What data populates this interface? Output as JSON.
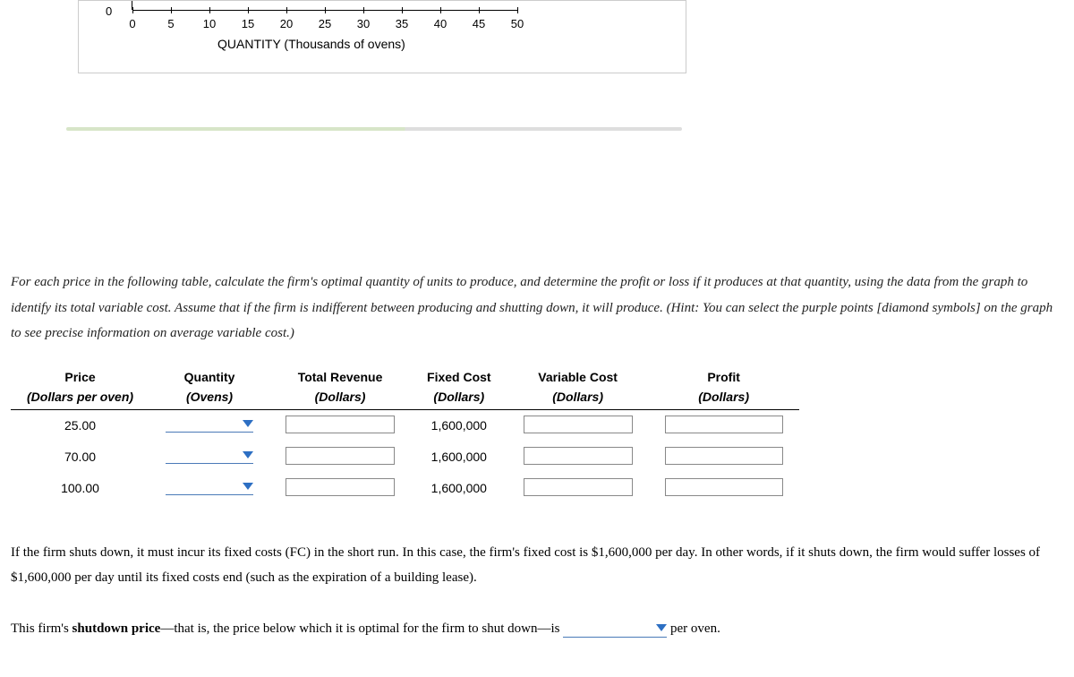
{
  "chart_data": {
    "type": "line",
    "title": "",
    "xlabel": "QUANTITY (Thousands of ovens)",
    "ylabel": "",
    "x_ticks": [
      0,
      5,
      10,
      15,
      20,
      25,
      30,
      35,
      40,
      45,
      50
    ],
    "y_tick_visible": 0,
    "xlim": [
      0,
      50
    ]
  },
  "instructions": "For each price in the following table, calculate the firm's optimal quantity of units to produce, and determine the profit or loss if it produces at that quantity, using the data from the graph to identify its total variable cost. Assume that if the firm is indifferent between producing and shutting down, it will produce. (Hint: You can select the purple points [diamond symbols] on the graph to see precise information on average variable cost.)",
  "table": {
    "headers": {
      "c1": "Price",
      "c2": "Quantity",
      "c3": "Total Revenue",
      "c4": "Fixed Cost",
      "c5": "Variable Cost",
      "c6": "Profit"
    },
    "subheaders": {
      "c1": "(Dollars per oven)",
      "c2": "(Ovens)",
      "c3": "(Dollars)",
      "c4": "(Dollars)",
      "c5": "(Dollars)",
      "c6": "(Dollars)"
    },
    "rows": [
      {
        "price": "25.00",
        "fixed": "1,600,000"
      },
      {
        "price": "70.00",
        "fixed": "1,600,000"
      },
      {
        "price": "100.00",
        "fixed": "1,600,000"
      }
    ]
  },
  "below1": "If the firm shuts down, it must incur its fixed costs (FC) in the short run. In this case, the firm's fixed cost is $1,600,000 per day. In other words, if it shuts down, the firm would suffer losses of $1,600,000 per day until its fixed costs end (such as the expiration of a building lease).",
  "shutdown_pre": "This firm's ",
  "shutdown_bold": "shutdown price",
  "shutdown_post": "—that is, the price below which it is optimal for the firm to shut down—is ",
  "shutdown_tail": " per oven."
}
